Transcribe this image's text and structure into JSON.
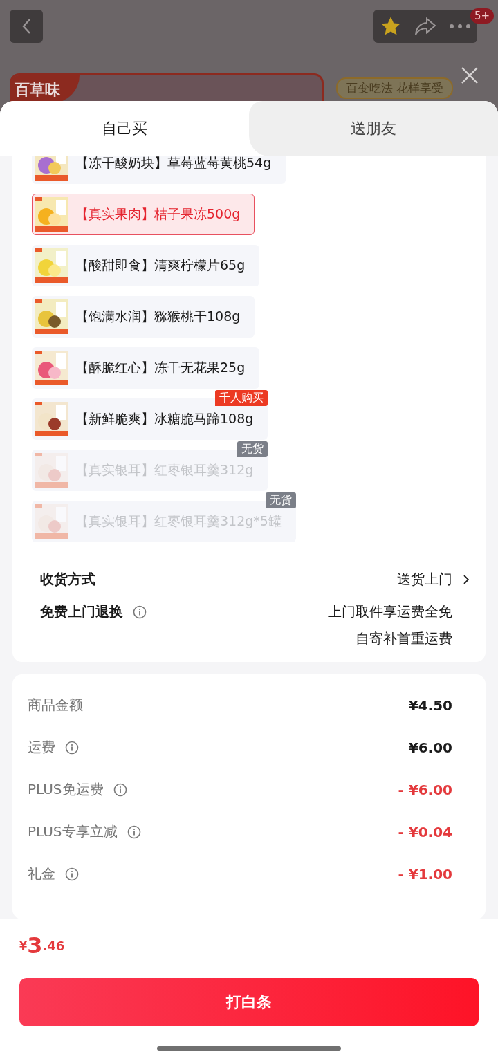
{
  "top_bar": {
    "badge": "5+"
  },
  "store": {
    "logo": "百草味",
    "slogan": "百变吃法 花样享受"
  },
  "tabs": [
    {
      "label": "自己买",
      "selected": true
    },
    {
      "label": "送朋友",
      "selected": false
    }
  ],
  "items": [
    {
      "title": "【冻干酸奶块】草莓蓝莓黄桃54g",
      "selected": false,
      "disabled": false
    },
    {
      "title": "【真实果肉】桔子果冻500g",
      "selected": true,
      "disabled": false
    },
    {
      "title": "【酸甜即食】清爽柠檬片65g",
      "selected": false,
      "disabled": false
    },
    {
      "title": "【饱满水润】猕猴桃干108g",
      "selected": false,
      "disabled": false
    },
    {
      "title": "【酥脆红心】冻干无花果25g",
      "selected": false,
      "disabled": false
    },
    {
      "title": "【新鲜脆爽】冰糖脆马蹄108g",
      "selected": false,
      "disabled": false,
      "badge": {
        "text": "千人购买",
        "kind": "hot"
      }
    },
    {
      "title": "【真实银耳】红枣银耳羹312g",
      "selected": false,
      "disabled": true,
      "badge": {
        "text": "无货",
        "kind": "stock"
      }
    },
    {
      "title": "【真实银耳】红枣银耳羹312g*5罐",
      "selected": false,
      "disabled": true,
      "badge": {
        "text": "无货",
        "kind": "stock"
      }
    }
  ],
  "delivery": [
    {
      "label": "收货方式",
      "info": false,
      "arrow": true,
      "value": [
        "送货上门"
      ]
    },
    {
      "label": "免费上门退换",
      "info": true,
      "arrow": false,
      "value": [
        "上门取件享运费全免",
        "自寄补首重运费"
      ]
    }
  ],
  "price_rows": [
    {
      "label": "商品金额",
      "info": false,
      "kind": "charge",
      "value": "¥4.50"
    },
    {
      "label": "运费",
      "info": true,
      "kind": "charge",
      "value": "¥6.00"
    },
    {
      "label": "PLUS免运费",
      "info": true,
      "kind": "discount",
      "value": "- ¥6.00"
    },
    {
      "label": "PLUS专享立减",
      "info": true,
      "kind": "discount",
      "value": "- ¥0.04"
    },
    {
      "label": "礼金",
      "info": true,
      "kind": "discount",
      "value": "- ¥1.00"
    }
  ],
  "total": {
    "currency": "¥",
    "integer": "3",
    "decimal": ".46"
  },
  "pay_button": "打白条"
}
